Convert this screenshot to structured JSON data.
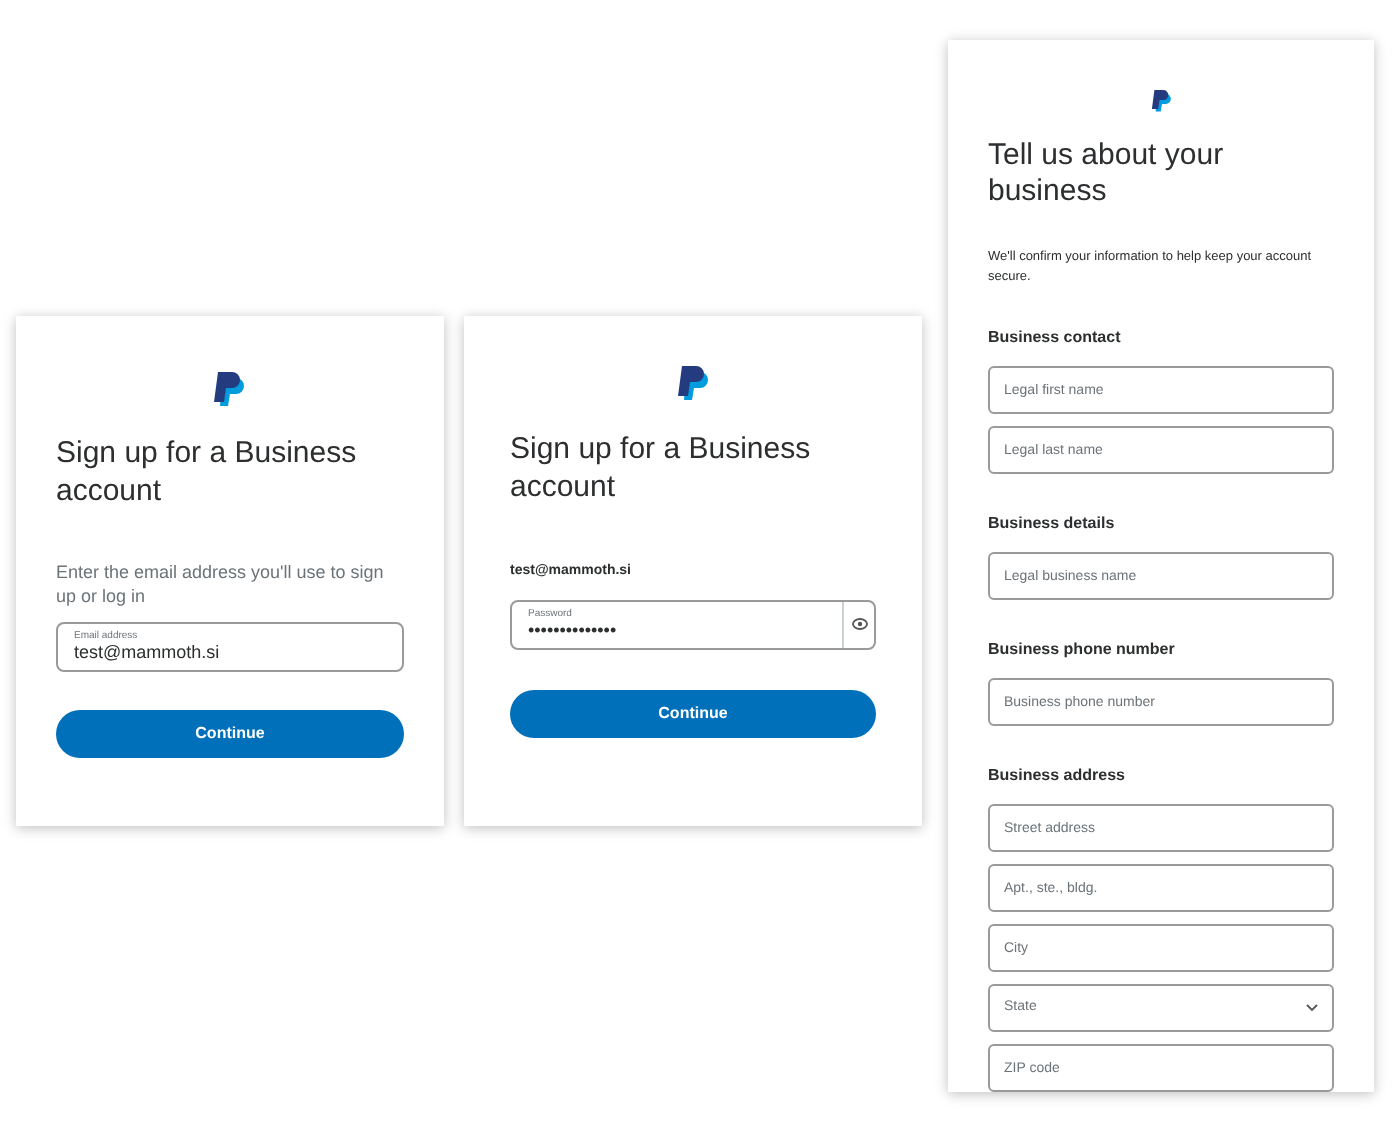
{
  "email_card": {
    "title": "Sign up for a Business account",
    "instruction": "Enter the email address you'll use to sign up or log in",
    "field": {
      "label": "Email address",
      "value": "test@mammoth.si"
    },
    "button": "Continue"
  },
  "password_card": {
    "title": "Sign up for a Business account",
    "email": "test@mammoth.si",
    "field": {
      "label": "Password",
      "value": "••••••••••••••"
    },
    "button": "Continue"
  },
  "business_card": {
    "title": "Tell us about your business",
    "note": "We'll confirm your information to help keep your account secure.",
    "sections": [
      {
        "heading": "Business contact",
        "fields": [
          {
            "kind": "text",
            "placeholder": "Legal first name"
          },
          {
            "kind": "text",
            "placeholder": "Legal last name"
          }
        ]
      },
      {
        "heading": "Business details",
        "fields": [
          {
            "kind": "text",
            "placeholder": "Legal business name"
          }
        ]
      },
      {
        "heading": "Business phone number",
        "fields": [
          {
            "kind": "text",
            "placeholder": "Business phone number"
          }
        ]
      },
      {
        "heading": "Business address",
        "fields": [
          {
            "kind": "text",
            "placeholder": "Street address"
          },
          {
            "kind": "text",
            "placeholder": "Apt., ste., bldg."
          },
          {
            "kind": "text",
            "placeholder": "City"
          },
          {
            "kind": "select",
            "placeholder": "State"
          },
          {
            "kind": "text",
            "placeholder": "ZIP code"
          }
        ]
      }
    ]
  }
}
